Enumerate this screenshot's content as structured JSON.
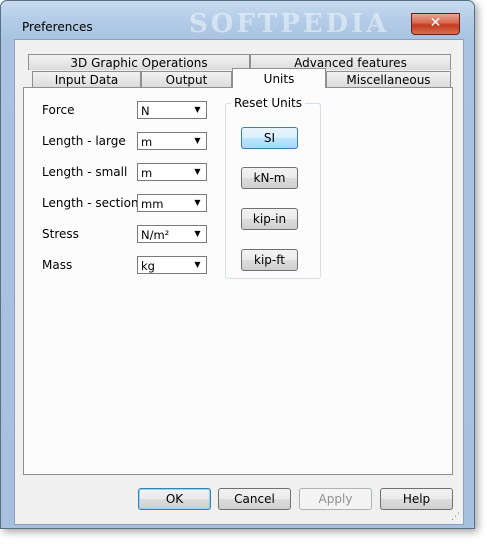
{
  "window": {
    "title": "Preferences",
    "watermark": "SOFTPEDIA",
    "close_glyph": "✕"
  },
  "tabs": {
    "row1": [
      {
        "label": "3D Graphic Operations"
      },
      {
        "label": "Advanced features"
      }
    ],
    "row2": [
      {
        "label": "Input Data"
      },
      {
        "label": "Output"
      },
      {
        "label": "Units",
        "active": true
      },
      {
        "label": "Miscellaneous"
      }
    ]
  },
  "units": {
    "rows": [
      {
        "label": "Force",
        "value": "N"
      },
      {
        "label": "Length - large",
        "value": "m"
      },
      {
        "label": "Length - small",
        "value": "m"
      },
      {
        "label": "Length - sections",
        "value": "mm"
      },
      {
        "label": "Stress",
        "value": "N/m²"
      },
      {
        "label": "Mass",
        "value": "kg"
      }
    ],
    "dropdown_icon": "chevron-down-icon"
  },
  "reset_units": {
    "title": "Reset Units",
    "buttons": [
      "SI",
      "kN-m",
      "kip-in",
      "kip-ft"
    ],
    "selected": "SI"
  },
  "dialog_buttons": {
    "ok": "OK",
    "cancel": "Cancel",
    "apply": "Apply",
    "help": "Help"
  },
  "colors": {
    "frame": "#a9c3e1",
    "close_button": "#c23a1e",
    "selected_button": "#bee6fd"
  }
}
